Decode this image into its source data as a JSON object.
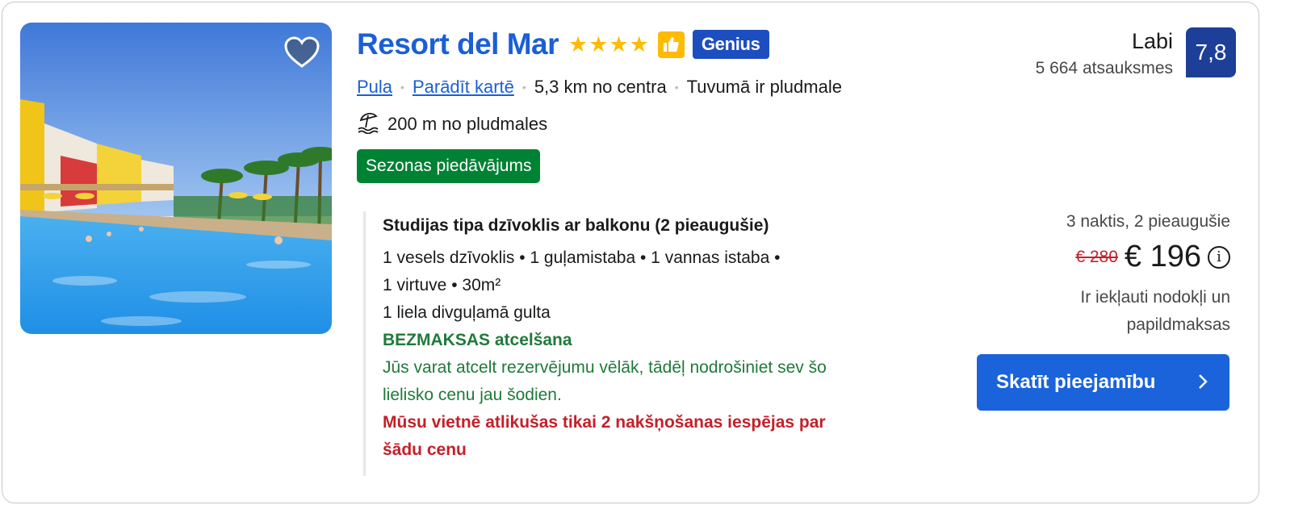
{
  "hotel": {
    "name": "Resort del Mar",
    "stars": "★★★★",
    "genius_label": "Genius",
    "city": "Pula",
    "map_link": "Parādīt kartē",
    "distance": "5,3 km no centra",
    "beach_nearby": "Tuvumā ir pludmale",
    "beach_distance": "200 m no pludmales",
    "deal_badge": "Sezonas piedāvājums"
  },
  "room": {
    "title": "Studijas tipa dzīvoklis ar balkonu (2 pieaugušie)",
    "features_line1": "1 vesels dzīvoklis • 1 guļamistaba • 1 vannas istaba •",
    "features_line2": "1 virtuve • 30m²",
    "bed": "1 liela divguļamā gulta",
    "free_cancel": "BEZMAKSAS atcelšana",
    "cancel_note_1": "Jūs varat atcelt rezervējumu vēlāk, tādēļ nodrošiniet sev šo",
    "cancel_note_2": "lielisko cenu jau šodien.",
    "scarcity_1": "Mūsu vietnē atlikušas tikai 2 nakšņošanas iespējas par",
    "scarcity_2": "šādu cenu"
  },
  "rating": {
    "word": "Labi",
    "reviews": "5 664 atsauksmes",
    "score": "7,8"
  },
  "price": {
    "stay": "3 naktis, 2 pieaugušie",
    "old": "€ 280",
    "new": "€ 196",
    "info_icon": "i",
    "tax_1": "Ir iekļauti nodokļi un",
    "tax_2": "papildmaksas"
  },
  "cta": {
    "label": "Skatīt pieejamību"
  },
  "colors": {
    "brand_blue": "#1a5fd6",
    "button_blue": "#1a63db",
    "score_blue": "#1d3f98",
    "genius_blue": "#1d4ec0",
    "green": "#008234",
    "red": "#c4202a",
    "star_yellow": "#febb02"
  },
  "icons": [
    "heart-icon",
    "thumbs-up-icon",
    "beach-umbrella-icon",
    "info-icon",
    "chevron-right-icon"
  ]
}
